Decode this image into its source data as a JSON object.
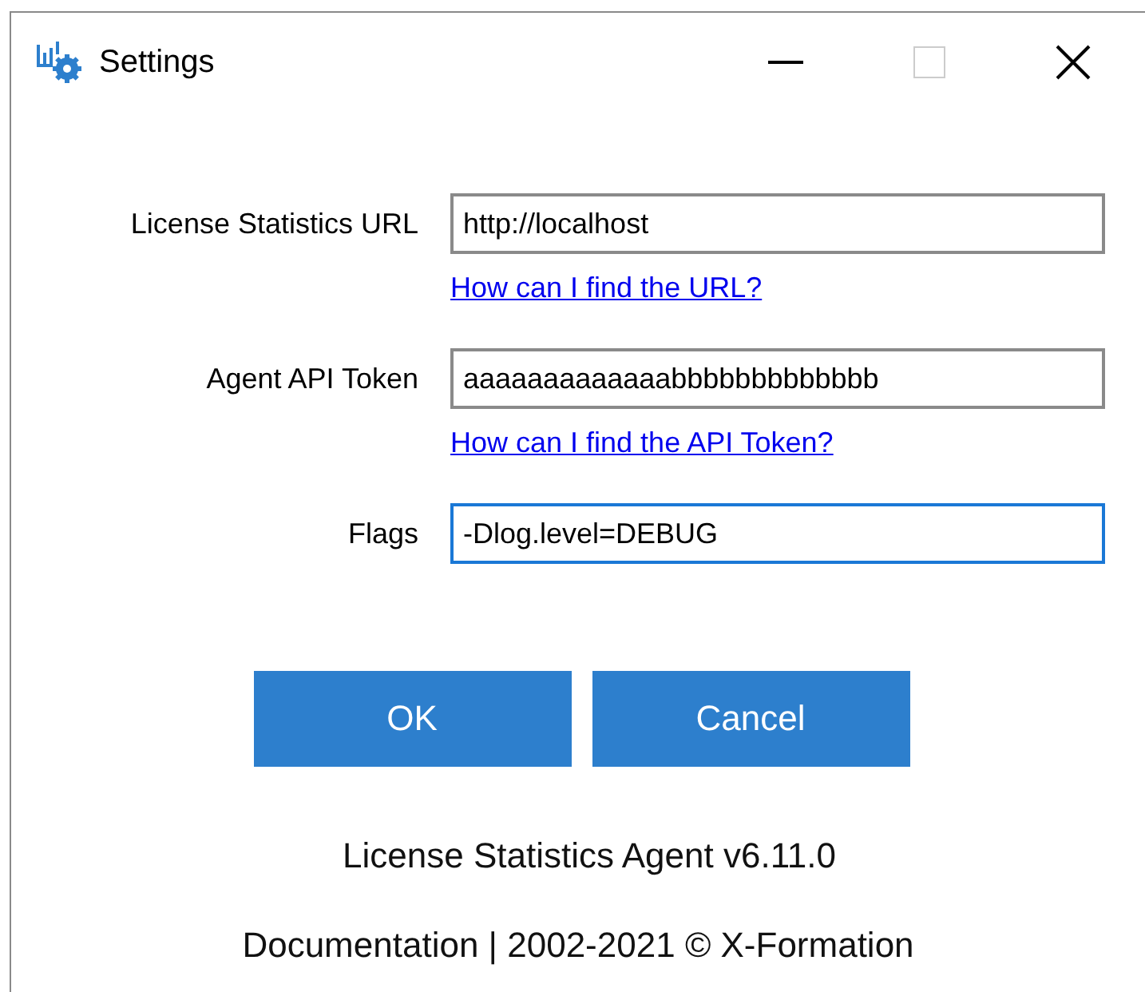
{
  "window": {
    "title": "Settings",
    "controls": [
      {
        "kind": "minimize",
        "disabled": false
      },
      {
        "kind": "maximize",
        "disabled": true
      },
      {
        "kind": "close",
        "disabled": false
      }
    ]
  },
  "fields": [
    {
      "label": "License Statistics URL",
      "value": "http://localhost",
      "focused": false,
      "link": "How can I find the URL?"
    },
    {
      "label": "Agent API Token",
      "value": "aaaaaaaaaaaaabbbbbbbbbbbbb",
      "focused": false,
      "link": "How can I find the API Token?"
    },
    {
      "label": "Flags",
      "value": "-Dlog.level=DEBUG",
      "focused": true
    }
  ],
  "buttons": [
    "OK",
    "Cancel"
  ],
  "version": "License Statistics Agent v6.11.0",
  "footer": "Documentation | 2002-2021 © X-Formation"
}
